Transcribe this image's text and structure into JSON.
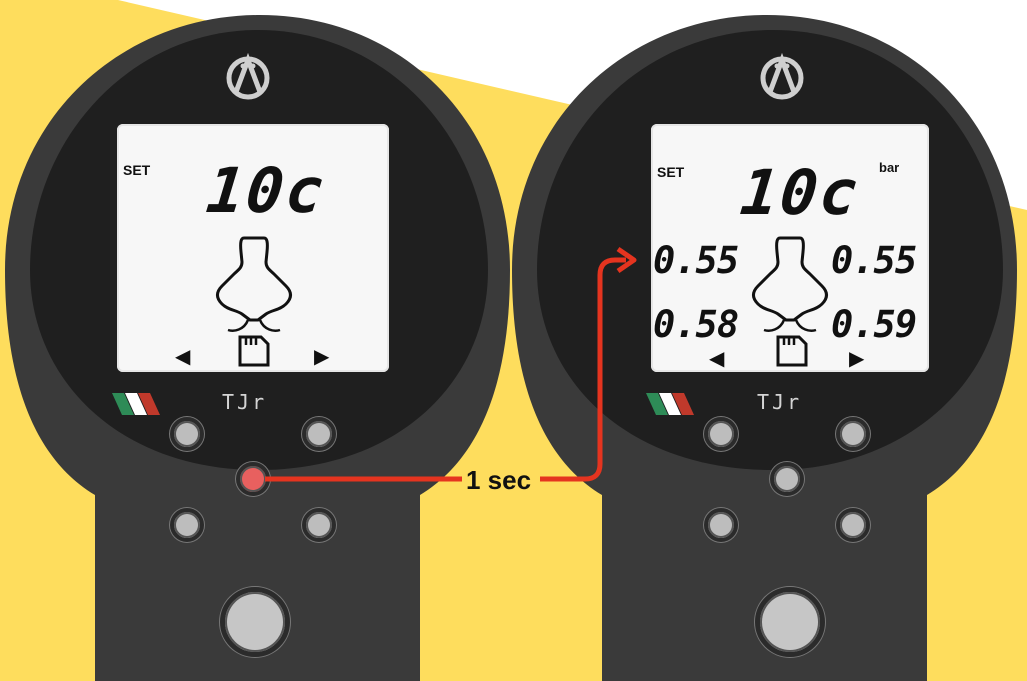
{
  "colors": {
    "background_accent": "#fedd5d",
    "device_body": "#3a3a3a",
    "screen": "#f7f7f7",
    "button": "#bdbdbd",
    "button_pressed": "#e8605f",
    "arrow_line": "#e5341f"
  },
  "icons": [
    "brand-logo-icon",
    "wheel-outline-icon",
    "sd-card-icon",
    "left-arrow-icon",
    "right-arrow-icon",
    "italian-flag-icon"
  ],
  "left_device": {
    "screen": {
      "set_label": "SET",
      "mode_value": "10c",
      "left_arrow": "◀",
      "right_arrow": "▶"
    },
    "brand_text": "TJr",
    "pressed_button": "center"
  },
  "right_device": {
    "screen": {
      "set_label": "SET",
      "mode_value": "10c",
      "unit": "bar",
      "front_left": "0.55",
      "front_right": "0.55",
      "rear_left": "0.58",
      "rear_right": "0.59",
      "left_arrow": "◀",
      "right_arrow": "▶"
    },
    "brand_text": "TJr"
  },
  "annotation": {
    "label": "1 sec"
  }
}
